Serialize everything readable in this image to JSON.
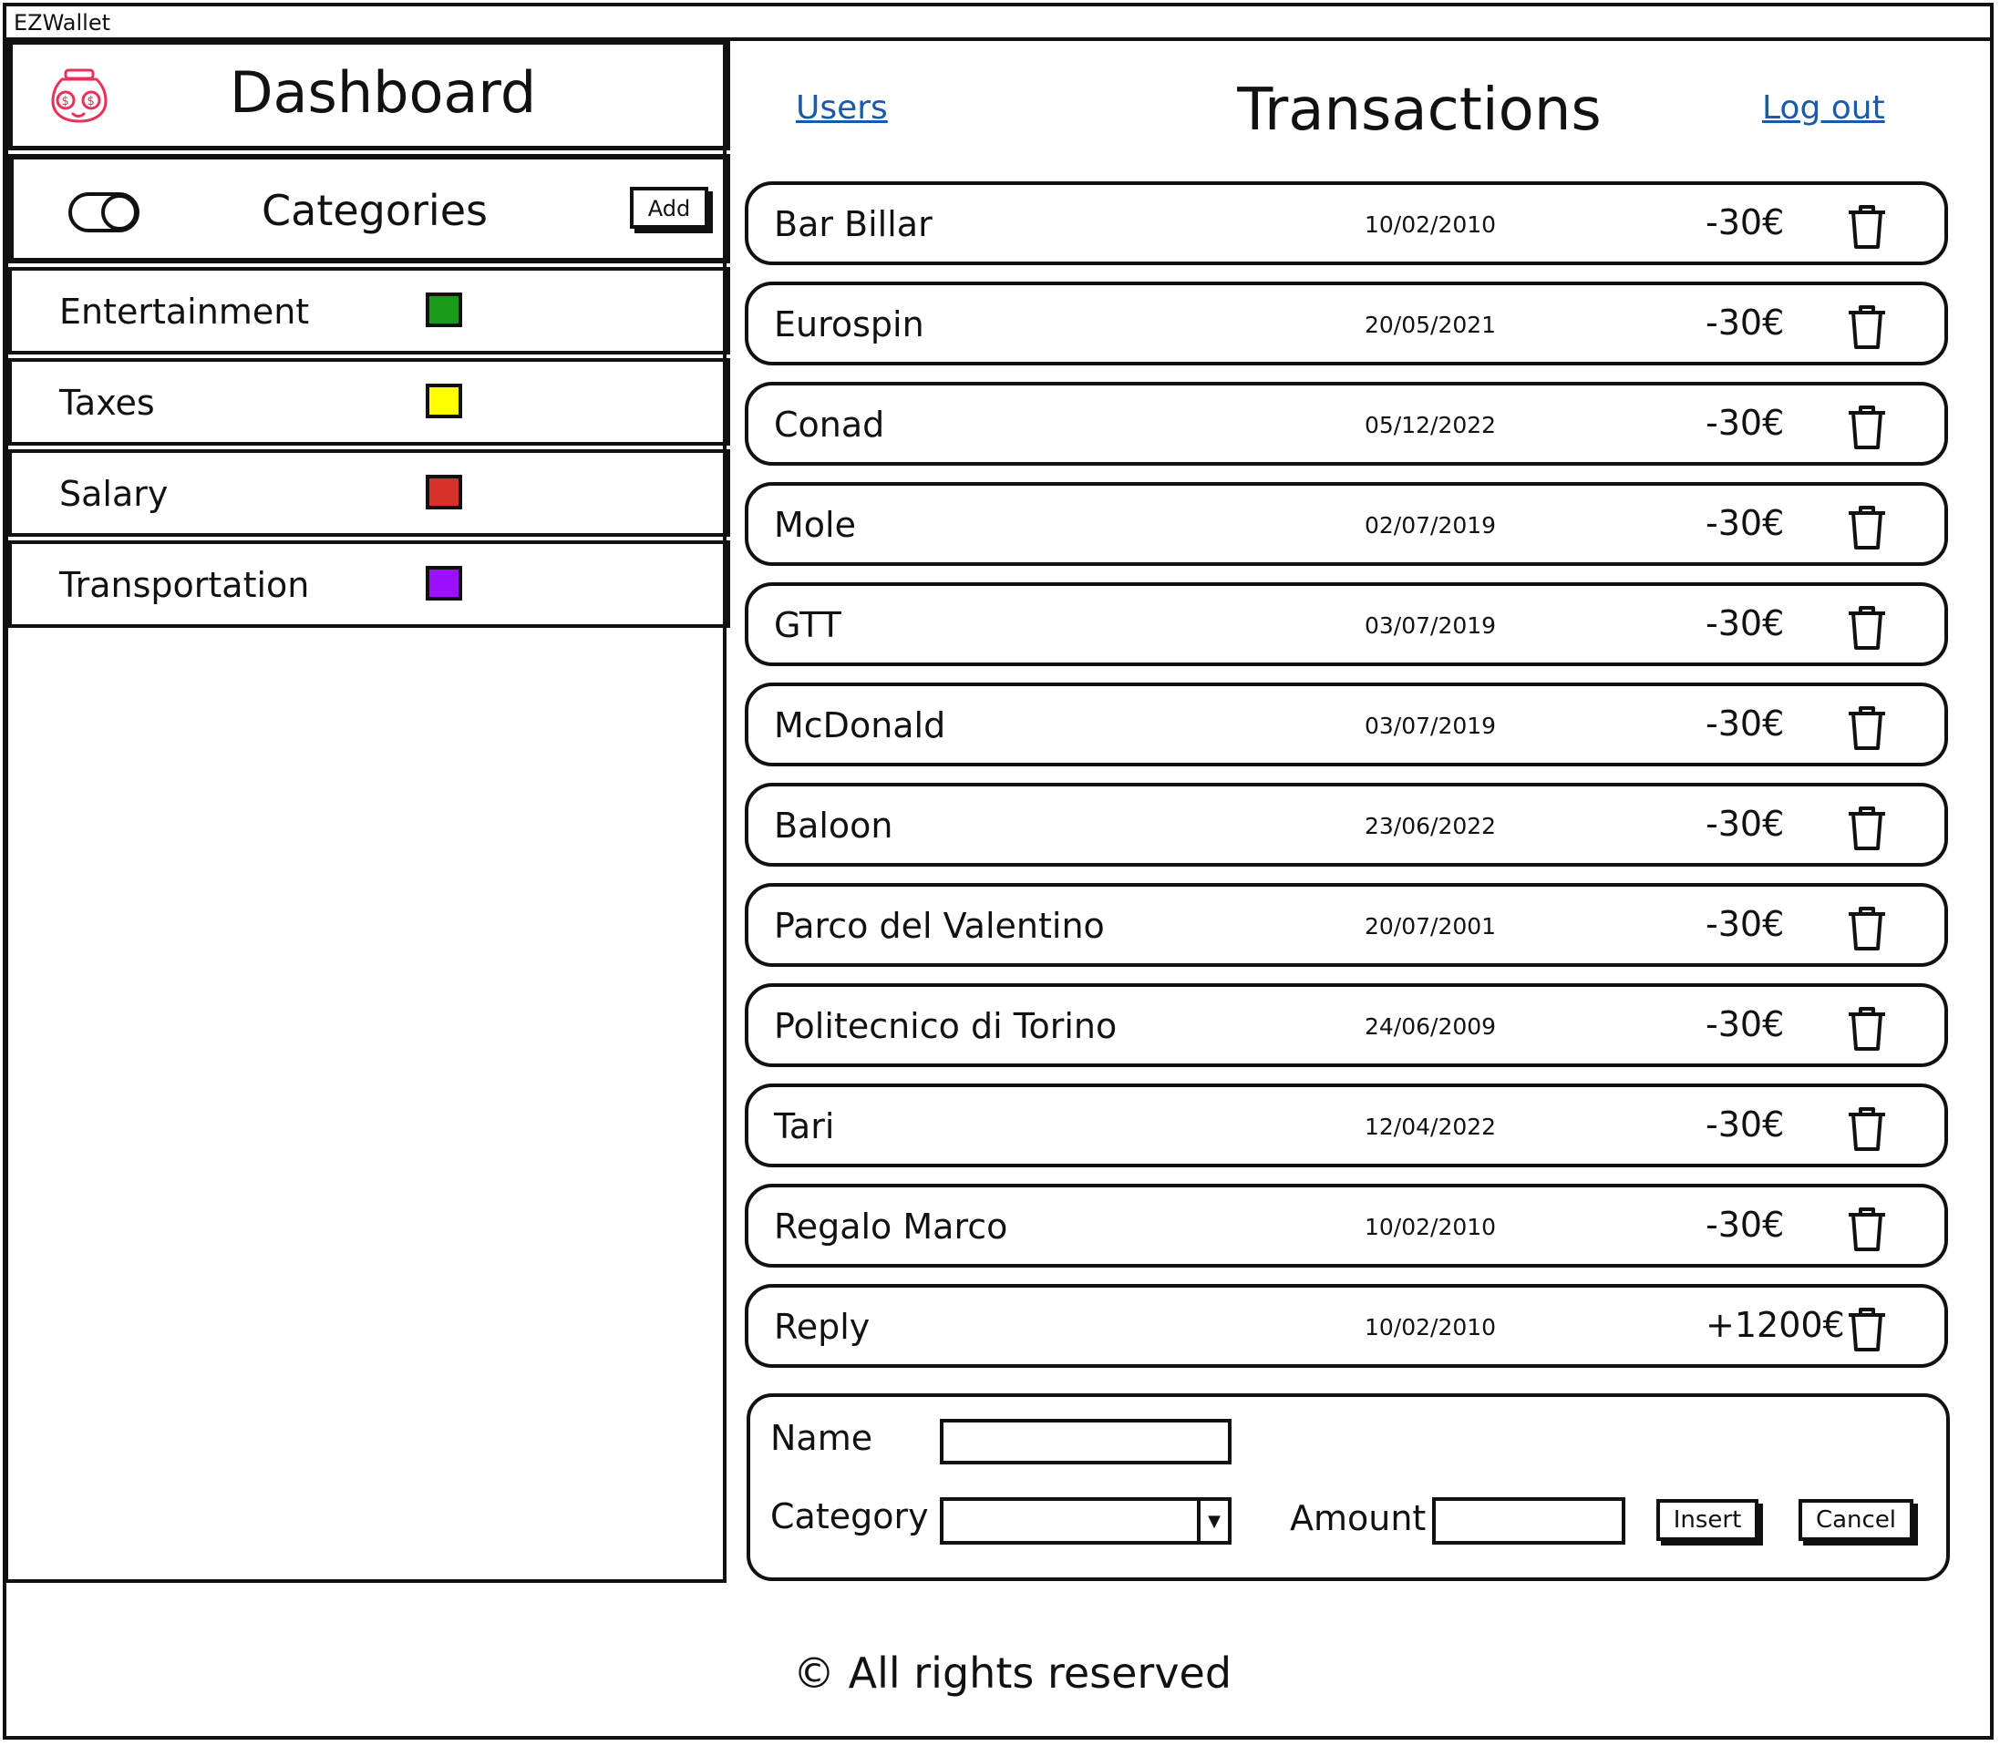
{
  "window": {
    "title": "EZWallet"
  },
  "sidebar": {
    "title": "Dashboard",
    "app_icon": "money-jar-icon",
    "categories_title": "Categories",
    "toggle_icon": "toggle-icon",
    "add_label": "Add",
    "categories": [
      {
        "label": "Entertainment",
        "color": "#1a9a1a"
      },
      {
        "label": "Taxes",
        "color": "#ffff00"
      },
      {
        "label": "Salary",
        "color": "#d8302a"
      },
      {
        "label": "Transportation",
        "color": "#9a10ff"
      }
    ]
  },
  "header": {
    "users_link": "Users",
    "title": "Transactions",
    "logout_link": "Log out"
  },
  "transactions": [
    {
      "name": "Bar Billar",
      "date": "10/02/2010",
      "amount": "-30€"
    },
    {
      "name": "Eurospin",
      "date": "20/05/2021",
      "amount": "-30€"
    },
    {
      "name": "Conad",
      "date": "05/12/2022",
      "amount": "-30€"
    },
    {
      "name": "Mole",
      "date": "02/07/2019",
      "amount": "-30€"
    },
    {
      "name": "GTT",
      "date": "03/07/2019",
      "amount": "-30€"
    },
    {
      "name": "McDonald",
      "date": "03/07/2019",
      "amount": "-30€"
    },
    {
      "name": "Baloon",
      "date": "23/06/2022",
      "amount": "-30€"
    },
    {
      "name": "Parco del Valentino",
      "date": "20/07/2001",
      "amount": "-30€"
    },
    {
      "name": "Politecnico di Torino",
      "date": "24/06/2009",
      "amount": "-30€"
    },
    {
      "name": "Tari",
      "date": "12/04/2022",
      "amount": "-30€"
    },
    {
      "name": "Regalo Marco",
      "date": "10/02/2010",
      "amount": "-30€"
    },
    {
      "name": "Reply",
      "date": "10/02/2010",
      "amount": "+1200€"
    }
  ],
  "form": {
    "name_label": "Name",
    "name_value": "",
    "category_label": "Category",
    "category_value": "",
    "amount_label": "Amount",
    "amount_value": "",
    "insert_label": "Insert",
    "cancel_label": "Cancel"
  },
  "footer": {
    "text": "© All rights reserved"
  }
}
